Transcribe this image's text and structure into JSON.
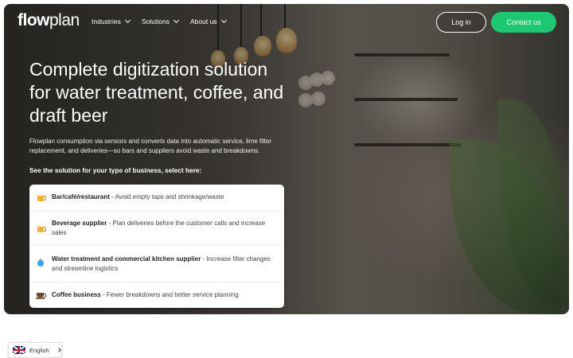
{
  "nav": {
    "logo_bold": "flow",
    "logo_light": "plan",
    "items": [
      {
        "label": "Industries"
      },
      {
        "label": "Solutions"
      },
      {
        "label": "About us"
      }
    ],
    "login_label": "Log in",
    "contact_label": "Contact us"
  },
  "hero": {
    "headline": "Complete digitization solution for water treatment, coffee, and draft beer",
    "subtext": "Flowplan consumption via sensors and converts data into automatic service, lime filter replacement, and deliveries—so bars and suppliers avoid waste and breakdowns.",
    "select_label": "See the solution for your type of business, select here:",
    "options": [
      {
        "icon": "beer-icon",
        "title": "Bar/café/restaurant",
        "desc": " - Avoid empty taps and shrinkage/waste"
      },
      {
        "icon": "beer-icon",
        "title": "Beverage supplier",
        "desc": " - Plan deliveries before the customer calls and increase sales"
      },
      {
        "icon": "water-drop-icon",
        "title": "Water treatment and commercial kitchen supplier",
        "desc": " - Increase filter changes and streamline logistics"
      },
      {
        "icon": "coffee-cup-icon",
        "title": "Coffee business",
        "desc": " - Fewer breakdowns and better service planning"
      }
    ]
  },
  "language": {
    "label": "English"
  },
  "colors": {
    "accent": "#1ec771"
  }
}
